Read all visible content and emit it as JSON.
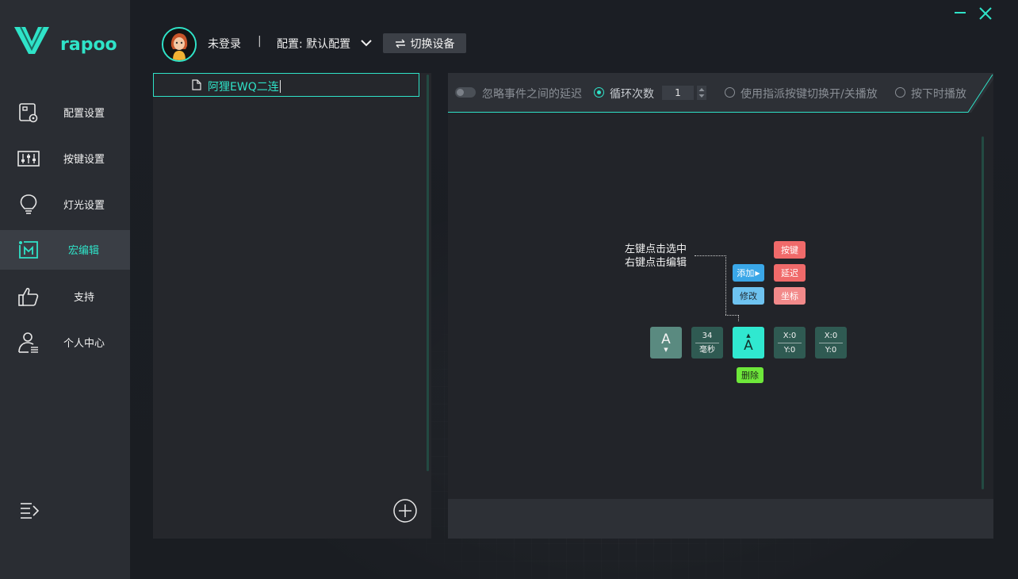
{
  "app": {
    "brand": "rapoo"
  },
  "sidebar": {
    "items": [
      {
        "label": "配置设置",
        "icon": "profile-settings-icon"
      },
      {
        "label": "按键设置",
        "icon": "key-sliders-icon"
      },
      {
        "label": "灯光设置",
        "icon": "lightbulb-icon"
      },
      {
        "label": "宏编辑",
        "icon": "macro-icon",
        "active": true
      },
      {
        "label": "支持",
        "icon": "thumbs-up-icon"
      },
      {
        "label": "个人中心",
        "icon": "user-center-icon"
      }
    ]
  },
  "header": {
    "login_status": "未登录",
    "separator": "|",
    "config_label": "配置: 默认配置",
    "switch_device": "切换设备"
  },
  "macro_list": {
    "items": [
      {
        "name": "阿狸EWQ二连",
        "selected": true
      }
    ]
  },
  "editor": {
    "toolbar": {
      "ignore_delay": "忽略事件之间的延迟",
      "loop_count_label": "循环次数",
      "loop_count_value": "1",
      "toggle_mode": "使用指派按键切换开/关播放",
      "hold_mode": "按下时播放",
      "selected_mode": "loop"
    },
    "hint": {
      "line1": "左键点击选中",
      "line2": "右键点击编辑"
    },
    "chips": {
      "add": "添加",
      "modify": "修改",
      "key": "按键",
      "delay": "延迟",
      "coord": "坐标",
      "delete": "删除"
    },
    "nodes": [
      {
        "type": "key-down",
        "label": "A",
        "arrow": "▼"
      },
      {
        "type": "delay",
        "value": "34",
        "unit": "毫秒"
      },
      {
        "type": "key-up",
        "label": "A",
        "arrow": "▲"
      },
      {
        "type": "coord",
        "x": "X:0",
        "y": "Y:0"
      },
      {
        "type": "coord",
        "x": "X:0",
        "y": "Y:0"
      }
    ]
  },
  "colors": {
    "accent": "#2fe3c8",
    "sidebar_bg": "#2a2d33",
    "panel_bg": "#25272c",
    "chip_blue": "#3aa7e8",
    "chip_red": "#f06a6a",
    "chip_green": "#6ee83a"
  }
}
